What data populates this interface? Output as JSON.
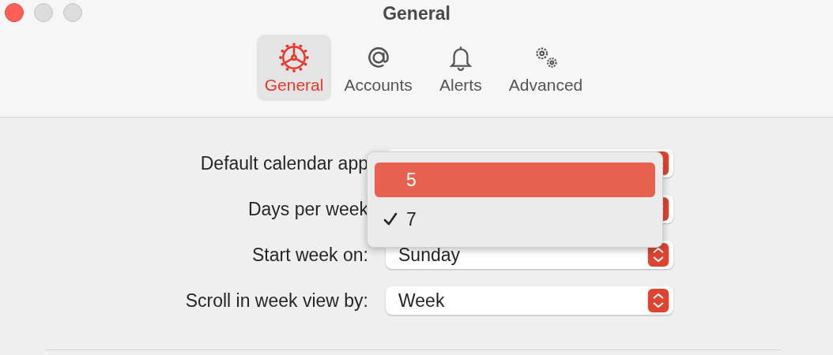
{
  "window": {
    "title": "General"
  },
  "tabs": [
    {
      "label": "General",
      "selected": true
    },
    {
      "label": "Accounts",
      "selected": false
    },
    {
      "label": "Alerts",
      "selected": false
    },
    {
      "label": "Advanced",
      "selected": false
    }
  ],
  "settings": [
    {
      "label": "Default calendar app"
    },
    {
      "label": "Days per week"
    },
    {
      "label": "Start week on:",
      "value": "Sunday"
    },
    {
      "label": "Scroll in week view by:",
      "value": "Week"
    }
  ],
  "open_menu": {
    "options": [
      {
        "label": "5",
        "checked": false,
        "highlighted": true
      },
      {
        "label": "7",
        "checked": true,
        "highlighted": false
      }
    ]
  }
}
